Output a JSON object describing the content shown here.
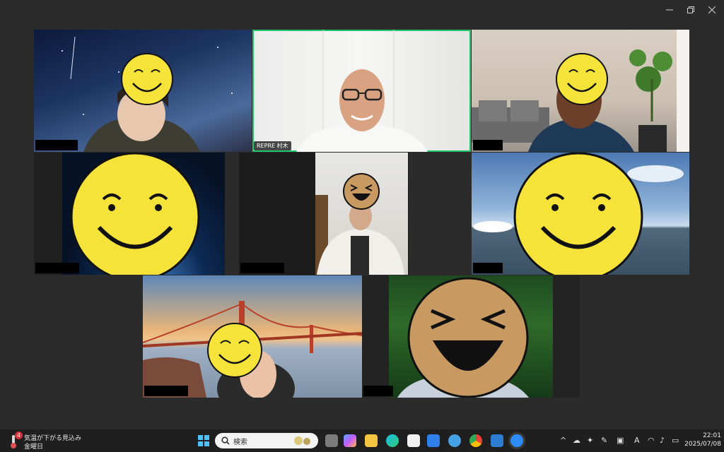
{
  "window": {
    "minimize_icon": "minimize-icon",
    "restore_icon": "restore-icon",
    "close_icon": "close-icon"
  },
  "participants": [
    {
      "id": "p1",
      "name_visible": false
    },
    {
      "id": "p2",
      "name": "REPRE 村木",
      "active_speaker": true
    },
    {
      "id": "p3",
      "name_visible": false
    },
    {
      "id": "p4",
      "name_visible": false
    },
    {
      "id": "p5",
      "name_visible": false
    },
    {
      "id": "p6",
      "name_visible": false
    },
    {
      "id": "p7",
      "name_visible": false
    },
    {
      "id": "p8",
      "name_visible": false
    }
  ],
  "taskbar": {
    "weather": {
      "badge": "4",
      "line1": "気温が下がる見込み",
      "line2": "金曜日"
    },
    "search_placeholder": "検索",
    "clock": {
      "time": "22:01",
      "date": "2025/07/08"
    },
    "ime_indicator": "A"
  },
  "colors": {
    "active_border": "#27c26c",
    "smiley_yellow": "#f5e33a",
    "smiley_tan": "#c89a62",
    "background": "#2b2b2b"
  }
}
